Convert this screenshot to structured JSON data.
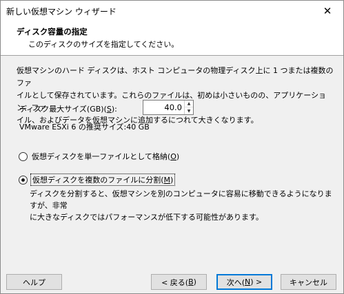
{
  "window": {
    "title": "新しい仮想マシン ウィザード",
    "close_glyph": "✕"
  },
  "header": {
    "title": "ディスク容量の指定",
    "subtitle": "このディスクのサイズを指定してください。"
  },
  "main": {
    "description_line1": "仮想マシンのハード ディスクは、ホスト コンピュータの物理ディスク上に 1 つまたは複数のファ",
    "description_line2": "イルとして保存されています。これらのファイルは、初めは小さいものの、アプリケーション、ファ",
    "description_line3": "イル、およびデータを仮想マシンに追加するにつれて大きくなります。",
    "max_size_label": "ディスク最大サイズ(GB)(",
    "max_size_key": "S",
    "max_size_label_end": "):",
    "max_size_value": "40.0",
    "recommended": "VMware ESXi 6 の推奨サイズ:40 GB",
    "options": [
      {
        "label": "仮想ディスクを単一ファイルとして格納(",
        "key": "O",
        "label_end": ")",
        "selected": false
      },
      {
        "label": "仮想ディスクを複数のファイルに分割(",
        "key": "M",
        "label_end": ")",
        "selected": true
      }
    ],
    "split_desc_line1": "ディスクを分割すると、仮想マシンを別のコンピュータに容易に移動できるようになりますが、非常",
    "split_desc_line2": "に大きなディスクではパフォーマンスが低下する可能性があります。"
  },
  "footer": {
    "help": "ヘルプ",
    "back": "< 戻る(",
    "back_key": "B",
    "back_end": ")",
    "next": "次へ(",
    "next_key": "N",
    "next_end": ") >",
    "cancel": "キャンセル"
  },
  "colors": {
    "accent": "#0078d7",
    "background": "#f0f0f0",
    "header_background": "#ffffff"
  },
  "icons": {
    "close": "close-icon",
    "spin_up": "spin-up-icon",
    "spin_down": "spin-down-icon"
  }
}
